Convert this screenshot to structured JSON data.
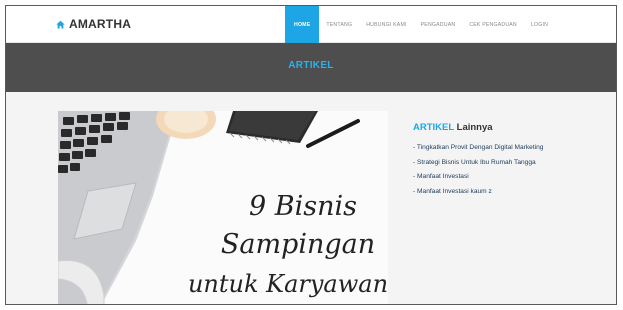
{
  "brand": {
    "name": "AMARTHA",
    "icon": "home-icon",
    "icon_color": "#1ea5e6"
  },
  "nav": {
    "items": [
      {
        "label": "HOME",
        "active": true
      },
      {
        "label": "TENTANG",
        "active": false
      },
      {
        "label": "HUBUNGI KAMI",
        "active": false
      },
      {
        "label": "PENGADUAN",
        "active": false
      },
      {
        "label": "CEK PENGADUAN",
        "active": false
      },
      {
        "label": "LOGIN",
        "active": false
      }
    ],
    "active_color": "#1ea5e6"
  },
  "banner": {
    "title": "ARTIKEL",
    "background": "#4e4e4e",
    "title_color": "#26b3f0"
  },
  "article": {
    "image_caption": [
      "9 Bisnis",
      "Sampingan",
      "untuk Karyawan"
    ]
  },
  "sidebar": {
    "title_accent": "ARTIKEL",
    "title_rest": " Lainnya",
    "links": [
      "- Tingkatkan Provit Dengan Digital Marketing",
      "- Strategi Bisnis Untuk Ibu Rumah Tangga",
      "- Manfaat Investasi",
      "- Manfaat Investasi kaum z"
    ]
  }
}
